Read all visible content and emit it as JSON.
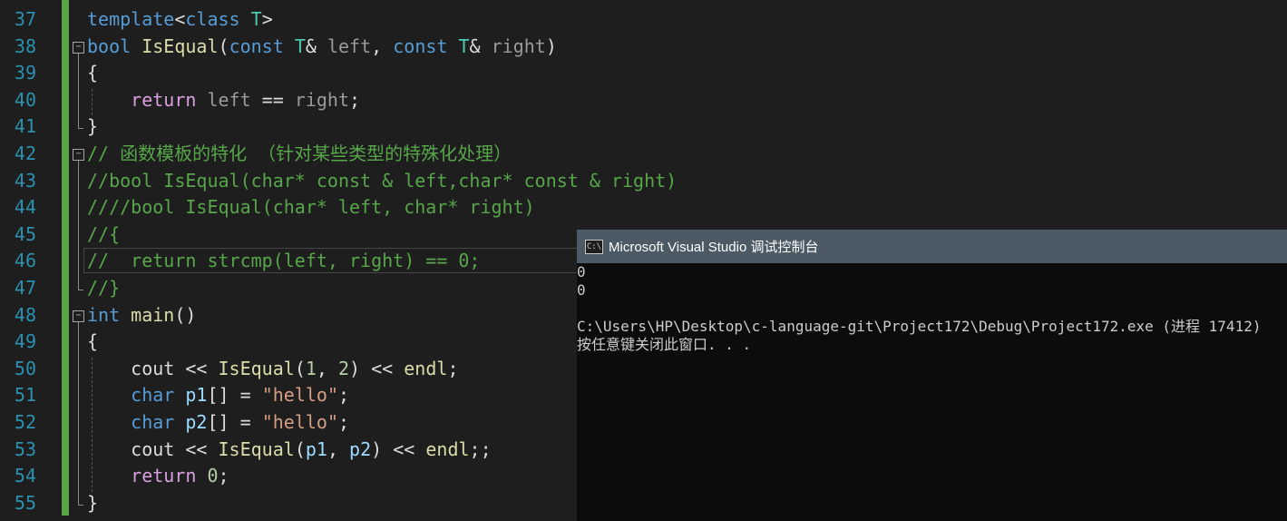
{
  "editor": {
    "line_numbers": [
      "37",
      "38",
      "39",
      "40",
      "41",
      "42",
      "43",
      "44",
      "45",
      "46",
      "47",
      "48",
      "49",
      "50",
      "51",
      "52",
      "53",
      "54",
      "55"
    ],
    "lines": [
      [
        {
          "t": "template",
          "c": "kw"
        },
        {
          "t": "<",
          "c": ""
        },
        {
          "t": "class",
          "c": "kw"
        },
        {
          "t": " ",
          "c": ""
        },
        {
          "t": "T",
          "c": "ty"
        },
        {
          "t": ">",
          "c": ""
        }
      ],
      [
        {
          "t": "bool",
          "c": "kw"
        },
        {
          "t": " ",
          "c": ""
        },
        {
          "t": "IsEqual",
          "c": "fn"
        },
        {
          "t": "(",
          "c": ""
        },
        {
          "t": "const",
          "c": "kw"
        },
        {
          "t": " ",
          "c": ""
        },
        {
          "t": "T",
          "c": "ty"
        },
        {
          "t": "& ",
          "c": ""
        },
        {
          "t": "left",
          "c": "pm"
        },
        {
          "t": ", ",
          "c": ""
        },
        {
          "t": "const",
          "c": "kw"
        },
        {
          "t": " ",
          "c": ""
        },
        {
          "t": "T",
          "c": "ty"
        },
        {
          "t": "& ",
          "c": ""
        },
        {
          "t": "right",
          "c": "pm"
        },
        {
          "t": ")",
          "c": ""
        }
      ],
      [
        {
          "t": "{",
          "c": ""
        }
      ],
      [
        {
          "t": "    ",
          "c": ""
        },
        {
          "t": "return",
          "c": "ctl"
        },
        {
          "t": " ",
          "c": ""
        },
        {
          "t": "left",
          "c": "pm"
        },
        {
          "t": " == ",
          "c": ""
        },
        {
          "t": "right",
          "c": "pm"
        },
        {
          "t": ";",
          "c": ""
        }
      ],
      [
        {
          "t": "}",
          "c": ""
        }
      ],
      [
        {
          "t": "// 函数模板的特化 （针对某些类型的特殊化处理）",
          "c": "cm"
        }
      ],
      [
        {
          "t": "//bool IsEqual(char* const & left,char* const & right)",
          "c": "cm"
        }
      ],
      [
        {
          "t": "////bool IsEqual(char* left, char* right)",
          "c": "cm"
        }
      ],
      [
        {
          "t": "//{",
          "c": "cm"
        }
      ],
      [
        {
          "t": "//  return strcmp(left, right) == 0;",
          "c": "cm"
        }
      ],
      [
        {
          "t": "//}",
          "c": "cm"
        }
      ],
      [
        {
          "t": "int",
          "c": "kw"
        },
        {
          "t": " ",
          "c": ""
        },
        {
          "t": "main",
          "c": "fn"
        },
        {
          "t": "()",
          "c": ""
        }
      ],
      [
        {
          "t": "{",
          "c": ""
        }
      ],
      [
        {
          "t": "    ",
          "c": ""
        },
        {
          "t": "cout",
          "c": ""
        },
        {
          "t": " << ",
          "c": ""
        },
        {
          "t": "IsEqual",
          "c": "fn"
        },
        {
          "t": "(",
          "c": ""
        },
        {
          "t": "1",
          "c": "num"
        },
        {
          "t": ", ",
          "c": ""
        },
        {
          "t": "2",
          "c": "num"
        },
        {
          "t": ") << ",
          "c": ""
        },
        {
          "t": "endl",
          "c": "fn"
        },
        {
          "t": ";",
          "c": ""
        }
      ],
      [
        {
          "t": "    ",
          "c": ""
        },
        {
          "t": "char",
          "c": "kw"
        },
        {
          "t": " ",
          "c": ""
        },
        {
          "t": "p1",
          "c": "var"
        },
        {
          "t": "[] = ",
          "c": ""
        },
        {
          "t": "\"hello\"",
          "c": "str"
        },
        {
          "t": ";",
          "c": ""
        }
      ],
      [
        {
          "t": "    ",
          "c": ""
        },
        {
          "t": "char",
          "c": "kw"
        },
        {
          "t": " ",
          "c": ""
        },
        {
          "t": "p2",
          "c": "var"
        },
        {
          "t": "[] = ",
          "c": ""
        },
        {
          "t": "\"hello\"",
          "c": "str"
        },
        {
          "t": ";",
          "c": ""
        }
      ],
      [
        {
          "t": "    ",
          "c": ""
        },
        {
          "t": "cout",
          "c": ""
        },
        {
          "t": " << ",
          "c": ""
        },
        {
          "t": "IsEqual",
          "c": "fn"
        },
        {
          "t": "(",
          "c": ""
        },
        {
          "t": "p1",
          "c": "var"
        },
        {
          "t": ", ",
          "c": ""
        },
        {
          "t": "p2",
          "c": "var"
        },
        {
          "t": ") << ",
          "c": ""
        },
        {
          "t": "endl",
          "c": "fn"
        },
        {
          "t": ";;",
          "c": ""
        }
      ],
      [
        {
          "t": "    ",
          "c": ""
        },
        {
          "t": "return",
          "c": "ctl"
        },
        {
          "t": " ",
          "c": ""
        },
        {
          "t": "0",
          "c": "num"
        },
        {
          "t": ";",
          "c": ""
        }
      ],
      [
        {
          "t": "}",
          "c": ""
        }
      ]
    ],
    "colors": {
      "background": "#1e1e1e",
      "line_number": "#2b91af",
      "change_bar": "#57a64a"
    }
  },
  "console": {
    "title": "Microsoft Visual Studio 调试控制台",
    "icon": "console-app-icon",
    "output": "0\n0\n\nC:\\Users\\HP\\Desktop\\c-language-git\\Project172\\Debug\\Project172.exe (进程 17412)\n按任意键关闭此窗口. . ."
  }
}
